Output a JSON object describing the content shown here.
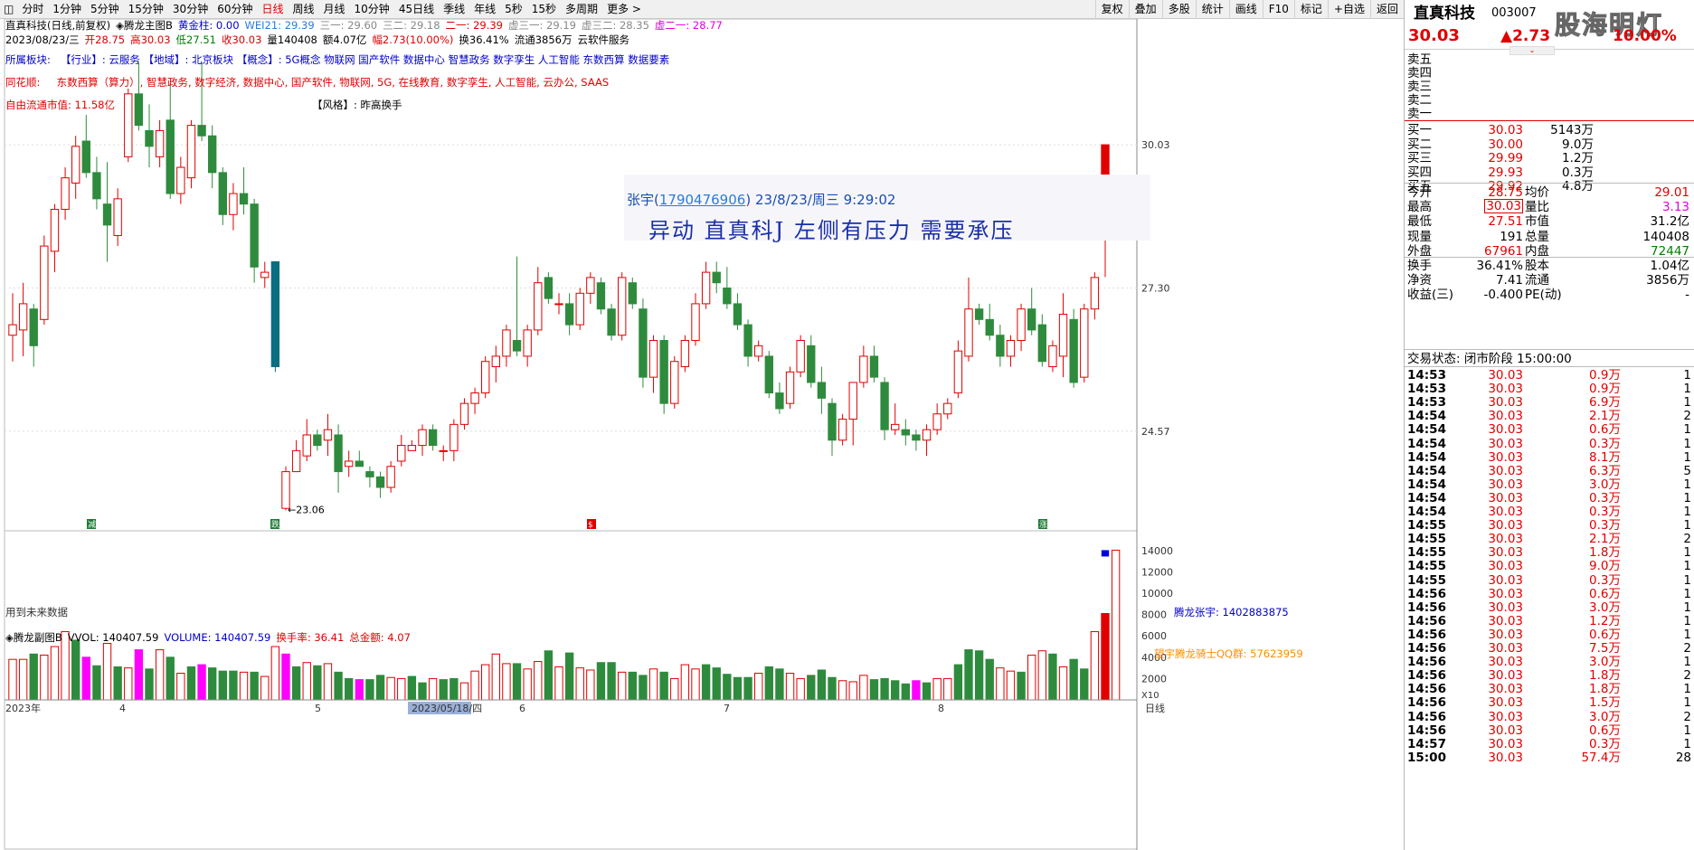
{
  "toolbar": {
    "tabs": [
      "分时",
      "1分钟",
      "5分钟",
      "15分钟",
      "30分钟",
      "60分钟",
      "日线",
      "周线",
      "月线",
      "10分钟",
      "45日线",
      "季线",
      "年线",
      "5秒",
      "15秒",
      "多周期",
      "更多 >"
    ],
    "active": "日线",
    "right": [
      "复权",
      "叠加",
      "多股",
      "统计",
      "画线",
      "F10",
      "标记",
      "+自选",
      "返回"
    ]
  },
  "chart": {
    "title_line": [
      {
        "t": "直真科技(日线,前复权)",
        "c": "#000"
      },
      {
        "t": "◈腾龙主图B",
        "c": "#000"
      },
      {
        "t": "黄金柱: 0.00",
        "c": "#0000cc"
      },
      {
        "t": "WEI21: 29.39",
        "c": "#2a7bd9"
      },
      {
        "t": "三一: 29.60",
        "c": "#888"
      },
      {
        "t": "三二: 29.18",
        "c": "#888"
      },
      {
        "t": "二一: 29.39",
        "c": "#e00000"
      },
      {
        "t": "虚三一: 29.19",
        "c": "#888"
      },
      {
        "t": "虚三二: 28.35",
        "c": "#888"
      },
      {
        "t": "虚二一: 28.77",
        "c": "#e000e0"
      }
    ],
    "quote_line": [
      {
        "t": "2023/08/23/三",
        "c": "#000"
      },
      {
        "t": "开28.75",
        "c": "#e00000"
      },
      {
        "t": "高30.03",
        "c": "#e00000"
      },
      {
        "t": "低27.51",
        "c": "#008000"
      },
      {
        "t": "收30.03",
        "c": "#e00000"
      },
      {
        "t": "量140408",
        "c": "#000"
      },
      {
        "t": "额4.07亿",
        "c": "#000"
      },
      {
        "t": "幅2.73(10.00%)",
        "c": "#e00000"
      },
      {
        "t": "换36.41%",
        "c": "#000"
      },
      {
        "t": "流通3856万",
        "c": "#000"
      },
      {
        "t": "云软件服务",
        "c": "#000"
      }
    ],
    "sector_label": "所属板块:",
    "sectors": "【行业】: 云服务  【地域】: 北京板块  【概念】: 5G概念 物联网 国产软件 数据中心 智慧政务 数字孪生 人工智能 东数西算 数据要素",
    "ths_label": "同花顺:",
    "ths": "东数西算（算力）, 智慧政务, 数字经济, 数据中心, 国产软件, 物联网, 5G, 在线教育, 数字孪生, 人工智能, 云办公, SAAS",
    "float_cap": "自由流通市值: 11.58亿",
    "style": "【风格】: 昨高换手",
    "future": "用到未来数据",
    "low_label": "←23.06",
    "wm": "腾龙张宇: 1402883875",
    "y_ticks": [
      "30.03",
      "27.30",
      "24.57"
    ],
    "x_ticks": [
      "2023年",
      "4",
      "5",
      "2023/05/18/四",
      "6",
      "7",
      "8"
    ],
    "marks": [
      "减",
      "跌",
      "$",
      "涨"
    ]
  },
  "annotation": {
    "id_name": "张宇",
    "id_num": "1790476906",
    "id_time": "23/8/23/周三 9:29:02",
    "message": "异动  直真科J  左侧有压力  需要承压"
  },
  "sub": {
    "legend": [
      {
        "t": "◈腾龙副图B",
        "c": "#000"
      },
      {
        "t": "VVOL: 140407.59",
        "c": "#000"
      },
      {
        "t": "VOLUME: 140407.59",
        "c": "#0000cc"
      },
      {
        "t": "换手率: 36.41",
        "c": "#e00000"
      },
      {
        "t": "总金额: 4.07",
        "c": "#e00000"
      }
    ],
    "qq": "望宇腾龙骑士QQ群: 57623959",
    "y_ticks": [
      "14000",
      "12000",
      "10000",
      "8000",
      "6000",
      "4000",
      "2000"
    ],
    "x10": "X10",
    "period": "日线"
  },
  "chart_data": {
    "type": "candlestick",
    "title": "直真科技(日线,前复权)",
    "ohlc": [
      [
        26.4,
        27.2,
        25.9,
        26.6
      ],
      [
        26.5,
        27.4,
        26.0,
        27.0
      ],
      [
        26.9,
        27.0,
        25.8,
        26.2
      ],
      [
        26.7,
        28.3,
        26.6,
        28.1
      ],
      [
        28.0,
        28.9,
        27.6,
        28.8
      ],
      [
        28.8,
        29.6,
        28.6,
        29.4
      ],
      [
        29.3,
        30.2,
        29.0,
        30.0
      ],
      [
        30.1,
        30.6,
        29.4,
        29.5
      ],
      [
        29.5,
        29.8,
        28.8,
        29.0
      ],
      [
        28.9,
        29.7,
        27.8,
        28.5
      ],
      [
        28.3,
        29.2,
        28.1,
        29.0
      ],
      [
        29.8,
        31.1,
        29.7,
        31.0
      ],
      [
        31.0,
        31.6,
        30.3,
        30.4
      ],
      [
        30.3,
        30.8,
        29.6,
        30.0
      ],
      [
        29.8,
        30.5,
        29.6,
        30.3
      ],
      [
        30.5,
        31.2,
        29.0,
        29.1
      ],
      [
        29.1,
        29.8,
        28.9,
        29.6
      ],
      [
        29.4,
        30.5,
        29.2,
        30.4
      ],
      [
        30.4,
        31.6,
        30.1,
        30.2
      ],
      [
        30.2,
        30.4,
        29.2,
        29.5
      ],
      [
        29.5,
        29.6,
        28.5,
        28.7
      ],
      [
        28.7,
        29.3,
        28.4,
        29.1
      ],
      [
        29.1,
        29.6,
        28.7,
        28.9
      ],
      [
        28.9,
        29.0,
        27.4,
        27.7
      ],
      [
        27.5,
        27.8,
        27.3,
        27.6
      ],
      [
        27.8,
        27.8,
        25.7,
        25.8
      ],
      [
        23.1,
        23.9,
        23.06,
        23.8
      ],
      [
        23.8,
        24.4,
        23.8,
        24.2
      ],
      [
        24.1,
        24.8,
        24.0,
        24.5
      ],
      [
        24.5,
        24.6,
        24.2,
        24.3
      ],
      [
        24.4,
        24.9,
        24.1,
        24.6
      ],
      [
        24.5,
        24.7,
        23.4,
        23.8
      ],
      [
        23.9,
        24.2,
        23.7,
        24.0
      ],
      [
        24.0,
        24.2,
        23.9,
        23.9
      ],
      [
        23.8,
        23.9,
        23.5,
        23.7
      ],
      [
        23.7,
        23.8,
        23.3,
        23.5
      ],
      [
        23.5,
        24.0,
        23.4,
        23.9
      ],
      [
        24.0,
        24.5,
        23.9,
        24.3
      ],
      [
        24.2,
        24.4,
        24.2,
        24.3
      ],
      [
        24.3,
        24.7,
        24.1,
        24.6
      ],
      [
        24.6,
        24.7,
        24.2,
        24.3
      ],
      [
        24.2,
        24.3,
        24.0,
        24.2
      ],
      [
        24.2,
        24.8,
        24.0,
        24.7
      ],
      [
        24.7,
        25.2,
        24.6,
        25.1
      ],
      [
        25.1,
        25.4,
        24.9,
        25.3
      ],
      [
        25.3,
        26.0,
        25.2,
        25.9
      ],
      [
        25.8,
        26.2,
        25.5,
        26.0
      ],
      [
        26.0,
        26.6,
        25.8,
        26.5
      ],
      [
        26.3,
        27.9,
        26.0,
        26.1
      ],
      [
        26.0,
        26.6,
        25.8,
        26.5
      ],
      [
        26.5,
        27.7,
        26.4,
        27.4
      ],
      [
        27.5,
        27.6,
        27.0,
        27.1
      ],
      [
        27.0,
        27.2,
        26.8,
        27.0
      ],
      [
        27.0,
        27.2,
        26.4,
        26.6
      ],
      [
        26.6,
        27.3,
        26.5,
        27.2
      ],
      [
        27.2,
        27.6,
        27.0,
        27.5
      ],
      [
        27.4,
        27.5,
        26.8,
        26.9
      ],
      [
        26.9,
        27.0,
        26.3,
        26.4
      ],
      [
        26.4,
        27.6,
        26.3,
        27.5
      ],
      [
        27.4,
        27.5,
        26.9,
        27.0
      ],
      [
        26.9,
        27.1,
        25.4,
        25.6
      ],
      [
        25.6,
        26.4,
        25.3,
        26.3
      ],
      [
        26.3,
        26.4,
        24.9,
        25.1
      ],
      [
        25.1,
        26.0,
        25.0,
        25.9
      ],
      [
        25.8,
        26.4,
        25.7,
        26.3
      ],
      [
        26.3,
        27.2,
        26.2,
        27.0
      ],
      [
        27.0,
        27.8,
        26.9,
        27.6
      ],
      [
        27.6,
        27.8,
        27.2,
        27.4
      ],
      [
        27.3,
        27.7,
        26.9,
        27.0
      ],
      [
        27.0,
        27.2,
        26.5,
        26.6
      ],
      [
        26.6,
        26.7,
        25.8,
        26.0
      ],
      [
        26.0,
        26.3,
        25.9,
        26.2
      ],
      [
        26.0,
        26.1,
        25.2,
        25.3
      ],
      [
        25.3,
        25.5,
        24.9,
        25.0
      ],
      [
        25.1,
        25.8,
        25.0,
        25.7
      ],
      [
        25.7,
        26.4,
        25.6,
        26.3
      ],
      [
        26.2,
        26.4,
        25.4,
        25.5
      ],
      [
        25.5,
        25.8,
        24.9,
        25.2
      ],
      [
        25.1,
        25.2,
        24.1,
        24.4
      ],
      [
        24.4,
        24.9,
        24.3,
        24.8
      ],
      [
        24.8,
        25.5,
        24.3,
        25.5
      ],
      [
        25.5,
        26.2,
        25.4,
        26.0
      ],
      [
        26.0,
        26.2,
        25.5,
        25.6
      ],
      [
        25.5,
        25.6,
        24.4,
        24.6
      ],
      [
        24.6,
        25.1,
        24.5,
        24.7
      ],
      [
        24.6,
        24.8,
        24.3,
        24.5
      ],
      [
        24.5,
        24.6,
        24.2,
        24.4
      ],
      [
        24.4,
        24.7,
        24.1,
        24.6
      ],
      [
        24.6,
        25.1,
        24.5,
        24.9
      ],
      [
        24.9,
        25.2,
        24.8,
        25.1
      ],
      [
        25.3,
        26.3,
        25.2,
        26.1
      ],
      [
        26.0,
        27.5,
        25.9,
        26.9
      ],
      [
        26.9,
        27.0,
        26.6,
        26.7
      ],
      [
        26.7,
        27.0,
        26.3,
        26.4
      ],
      [
        26.4,
        26.6,
        25.8,
        26.0
      ],
      [
        26.0,
        26.4,
        25.8,
        26.3
      ],
      [
        26.3,
        27.0,
        26.1,
        26.9
      ],
      [
        26.9,
        27.3,
        26.4,
        26.5
      ],
      [
        26.6,
        26.8,
        25.8,
        25.9
      ],
      [
        25.8,
        26.3,
        25.7,
        26.2
      ],
      [
        26.0,
        27.2,
        25.6,
        26.8
      ],
      [
        26.7,
        26.9,
        25.4,
        25.5
      ],
      [
        25.6,
        27.0,
        25.5,
        26.9
      ],
      [
        26.9,
        27.6,
        26.7,
        27.5
      ],
      [
        28.75,
        30.03,
        27.51,
        30.03
      ]
    ],
    "volume": [
      3800,
      3800,
      4300,
      4200,
      5000,
      6400,
      5600,
      4000,
      3200,
      5300,
      3100,
      3000,
      4700,
      2900,
      4700,
      4000,
      2500,
      3100,
      3300,
      3000,
      2700,
      2700,
      2600,
      2600,
      2200,
      5000,
      4300,
      3100,
      3500,
      3200,
      3400,
      2600,
      2000,
      1900,
      1900,
      2300,
      2100,
      2000,
      2200,
      1600,
      2000,
      1900,
      2000,
      1600,
      2700,
      3300,
      4300,
      3400,
      3400,
      2900,
      3600,
      4600,
      3100,
      4400,
      3000,
      2800,
      3500,
      3500,
      2600,
      2600,
      2300,
      2900,
      2600,
      2000,
      3300,
      2900,
      3300,
      3000,
      2400,
      2100,
      2100,
      2500,
      3100,
      2900,
      2500,
      2000,
      2300,
      2800,
      2100,
      1800,
      1700,
      2300,
      1900,
      2000,
      1800,
      1500,
      1800,
      1600,
      2000,
      2000,
      3300,
      4700,
      4600,
      3800,
      3000,
      2700,
      2600,
      4200,
      4600,
      4300,
      3100,
      3800,
      2900,
      6400,
      8100,
      14041
    ],
    "vol_color": [
      "r",
      "r",
      "g",
      "r",
      "r",
      "r",
      "g",
      "m",
      "g",
      "r",
      "g",
      "r",
      "m",
      "g",
      "r",
      "g",
      "r",
      "g",
      "m",
      "g",
      "g",
      "g",
      "r",
      "g",
      "r",
      "r",
      "m",
      "g",
      "r",
      "g",
      "r",
      "g",
      "g",
      "m",
      "g",
      "g",
      "r",
      "r",
      "g",
      "g",
      "r",
      "g",
      "g",
      "r",
      "r",
      "r",
      "r",
      "r",
      "g",
      "r",
      "r",
      "g",
      "r",
      "g",
      "r",
      "r",
      "g",
      "g",
      "r",
      "g",
      "g",
      "r",
      "g",
      "r",
      "r",
      "r",
      "g",
      "g",
      "g",
      "g",
      "g",
      "r",
      "g",
      "g",
      "r",
      "r",
      "g",
      "g",
      "g",
      "r",
      "r",
      "r",
      "g",
      "g",
      "g",
      "g",
      "m",
      "g",
      "r",
      "r",
      "g",
      "g",
      "g",
      "g",
      "r",
      "r",
      "g",
      "r",
      "r",
      "g",
      "r",
      "g",
      "g",
      "r",
      "r",
      "r"
    ]
  },
  "quote": {
    "name": "直真科技",
    "code": "003007",
    "price": "30.03",
    "change": "▲2.73",
    "pct": "10.00%",
    "asks": [
      {
        "l": "卖五",
        "p": "",
        "v": ""
      },
      {
        "l": "卖四",
        "p": "",
        "v": ""
      },
      {
        "l": "卖三",
        "p": "",
        "v": ""
      },
      {
        "l": "卖二",
        "p": "",
        "v": ""
      },
      {
        "l": "卖一",
        "p": "",
        "v": ""
      }
    ],
    "bids": [
      {
        "l": "买一",
        "p": "30.03",
        "v": "5143万"
      },
      {
        "l": "买二",
        "p": "30.00",
        "v": "9.0万"
      },
      {
        "l": "买三",
        "p": "29.99",
        "v": "1.2万"
      },
      {
        "l": "买四",
        "p": "29.93",
        "v": "0.3万"
      },
      {
        "l": "买五",
        "p": "29.92",
        "v": "4.8万"
      }
    ],
    "stats": [
      {
        "a": "今开",
        "av": "28.75",
        "ac": "red",
        "b": "均价",
        "bv": "29.01",
        "bc": "red"
      },
      {
        "a": "最高",
        "av": "30.03",
        "ac": "red",
        "b": "量比",
        "bv": "3.13",
        "bc": "mag"
      },
      {
        "a": "最低",
        "av": "27.51",
        "ac": "red",
        "b": "市值",
        "bv": "31.2亿",
        "bc": ""
      },
      {
        "a": "现量",
        "av": "191",
        "ac": "",
        "b": "总量",
        "bv": "140408",
        "bc": ""
      },
      {
        "a": "外盘",
        "av": "67961",
        "ac": "red",
        "b": "内盘",
        "bv": "72447",
        "bc": "grn"
      },
      {
        "a": "换手",
        "av": "36.41%",
        "ac": "",
        "b": "股本",
        "bv": "1.04亿",
        "bc": ""
      },
      {
        "a": "净资",
        "av": "7.41",
        "ac": "",
        "b": "流通",
        "bv": "3856万",
        "bc": ""
      },
      {
        "a": "收益(三)",
        "av": "-0.400",
        "ac": "",
        "b": "PE(动)",
        "bv": "-",
        "bc": ""
      }
    ],
    "status": "交易状态: 闭市阶段 15:00:00",
    "ticks": [
      [
        "14:53",
        "30.03",
        "0.9万",
        "1"
      ],
      [
        "14:53",
        "30.03",
        "0.9万",
        "1"
      ],
      [
        "14:53",
        "30.03",
        "6.9万",
        "1"
      ],
      [
        "14:54",
        "30.03",
        "2.1万",
        "2"
      ],
      [
        "14:54",
        "30.03",
        "0.6万",
        "1"
      ],
      [
        "14:54",
        "30.03",
        "0.3万",
        "1"
      ],
      [
        "14:54",
        "30.03",
        "8.1万",
        "1"
      ],
      [
        "14:54",
        "30.03",
        "6.3万",
        "5"
      ],
      [
        "14:54",
        "30.03",
        "3.0万",
        "1"
      ],
      [
        "14:54",
        "30.03",
        "0.3万",
        "1"
      ],
      [
        "14:54",
        "30.03",
        "0.3万",
        "1"
      ],
      [
        "14:55",
        "30.03",
        "0.3万",
        "1"
      ],
      [
        "14:55",
        "30.03",
        "2.1万",
        "2"
      ],
      [
        "14:55",
        "30.03",
        "1.8万",
        "1"
      ],
      [
        "14:55",
        "30.03",
        "9.0万",
        "1"
      ],
      [
        "14:55",
        "30.03",
        "0.3万",
        "1"
      ],
      [
        "14:56",
        "30.03",
        "0.6万",
        "1"
      ],
      [
        "14:56",
        "30.03",
        "3.0万",
        "1"
      ],
      [
        "14:56",
        "30.03",
        "1.2万",
        "1"
      ],
      [
        "14:56",
        "30.03",
        "0.6万",
        "1"
      ],
      [
        "14:56",
        "30.03",
        "7.5万",
        "2"
      ],
      [
        "14:56",
        "30.03",
        "3.0万",
        "1"
      ],
      [
        "14:56",
        "30.03",
        "1.8万",
        "2"
      ],
      [
        "14:56",
        "30.03",
        "1.8万",
        "1"
      ],
      [
        "14:56",
        "30.03",
        "1.5万",
        "1"
      ],
      [
        "14:56",
        "30.03",
        "3.0万",
        "2"
      ],
      [
        "14:56",
        "30.03",
        "0.6万",
        "1"
      ],
      [
        "14:57",
        "30.03",
        "0.3万",
        "1"
      ],
      [
        "15:00",
        "30.03",
        "57.4万",
        "28"
      ]
    ]
  },
  "logo_text": "股海明灯"
}
